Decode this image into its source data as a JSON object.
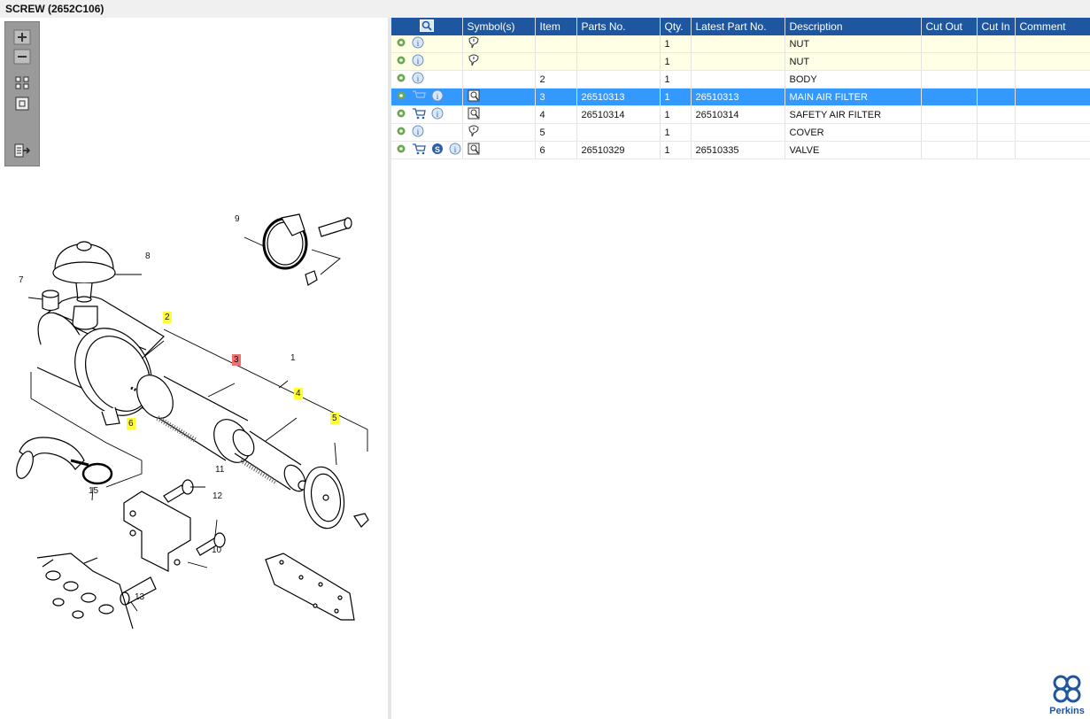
{
  "title": "SCREW (2652C106)",
  "colors": {
    "header_bg": "#1e56a0",
    "selected_row": "#3399ff",
    "highlight_callout": "#ffff33",
    "selected_callout": "#f07070"
  },
  "toolbar": [
    "zoom-in-icon",
    "zoom-out-icon",
    "fit-page-icon",
    "actual-size-icon",
    "export-icon"
  ],
  "callouts": {
    "c1": "1",
    "c2": "2",
    "c3": "3",
    "c4": "4",
    "c5": "5",
    "c6": "6",
    "c7": "7",
    "c8": "8",
    "c9": "9",
    "c10": "10",
    "c11": "11",
    "c12": "12",
    "c13": "13",
    "c15": "15"
  },
  "table": {
    "headers": {
      "symbols": "Symbol(s)",
      "item": "Item",
      "part_no": "Parts No.",
      "qty": "Qty.",
      "latest": "Latest Part No.",
      "description": "Description",
      "cut_out": "Cut Out",
      "cut_in": "Cut In",
      "comment": "Comment"
    },
    "rows": [
      {
        "item": "",
        "part_no": "",
        "qty": "1",
        "latest": "",
        "description": "NUT",
        "cut_out": "",
        "cut_in": "",
        "comment": ""
      },
      {
        "item": "",
        "part_no": "",
        "qty": "1",
        "latest": "",
        "description": "NUT",
        "cut_out": "",
        "cut_in": "",
        "comment": ""
      },
      {
        "item": "2",
        "part_no": "",
        "qty": "1",
        "latest": "",
        "description": "BODY",
        "cut_out": "",
        "cut_in": "",
        "comment": ""
      },
      {
        "item": "3",
        "part_no": "26510313",
        "qty": "1",
        "latest": "26510313",
        "description": "MAIN AIR FILTER",
        "cut_out": "",
        "cut_in": "",
        "comment": ""
      },
      {
        "item": "4",
        "part_no": "26510314",
        "qty": "1",
        "latest": "26510314",
        "description": "SAFETY AIR FILTER",
        "cut_out": "",
        "cut_in": "",
        "comment": ""
      },
      {
        "item": "5",
        "part_no": "",
        "qty": "1",
        "latest": "",
        "description": "COVER",
        "cut_out": "",
        "cut_in": "",
        "comment": ""
      },
      {
        "item": "6",
        "part_no": "26510329",
        "qty": "1",
        "latest": "26510335",
        "description": "VALVE",
        "cut_out": "",
        "cut_in": "",
        "comment": ""
      }
    ]
  },
  "logo": {
    "text": "Perkins"
  }
}
